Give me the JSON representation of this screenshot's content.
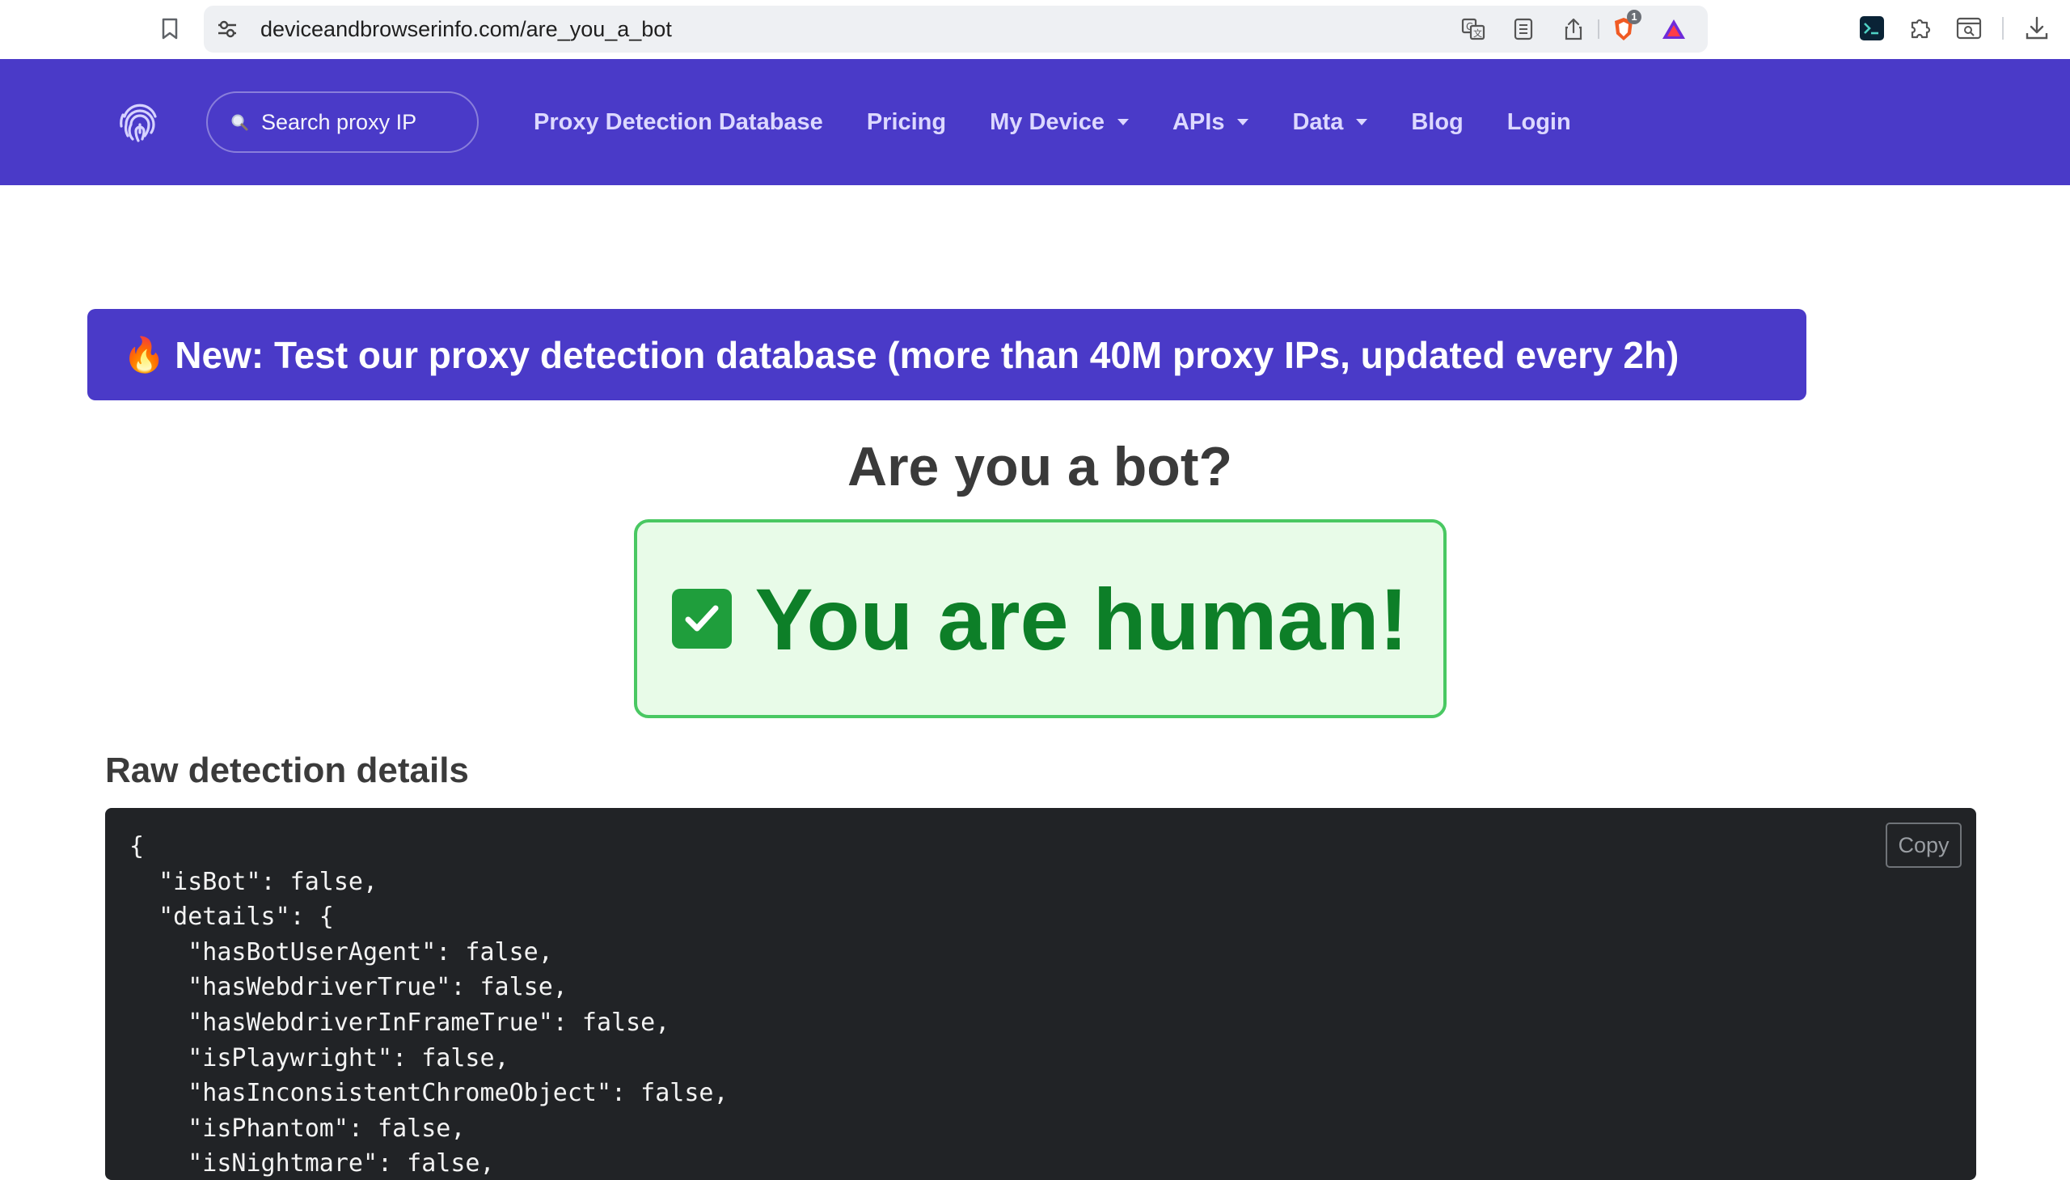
{
  "browser": {
    "url": "deviceandbrowserinfo.com/are_you_a_bot",
    "brave_shield_count": "1"
  },
  "navbar": {
    "search_placeholder": "Search proxy IP",
    "links": [
      {
        "label": "Proxy Detection Database",
        "dropdown": false
      },
      {
        "label": "Pricing",
        "dropdown": false
      },
      {
        "label": "My Device",
        "dropdown": true
      },
      {
        "label": "APIs",
        "dropdown": true
      },
      {
        "label": "Data",
        "dropdown": true
      },
      {
        "label": "Blog",
        "dropdown": false
      },
      {
        "label": "Login",
        "dropdown": false
      }
    ]
  },
  "banner": {
    "icon": "fire-icon",
    "text": "New: Test our proxy detection database (more than 40M proxy IPs, updated every 2h)"
  },
  "page": {
    "heading": "Are you a bot?",
    "result_text": "You are human!",
    "result_icon": "check-mark-icon",
    "details_heading": "Raw detection details"
  },
  "code": {
    "copy_label": "Copy",
    "lines": [
      "{",
      "  \"isBot\": false,",
      "  \"details\": {",
      "    \"hasBotUserAgent\": false,",
      "    \"hasWebdriverTrue\": false,",
      "    \"hasWebdriverInFrameTrue\": false,",
      "    \"isPlaywright\": false,",
      "    \"hasInconsistentChromeObject\": false,",
      "    \"isPhantom\": false,",
      "    \"isNightmare\": false,"
    ]
  },
  "colors": {
    "brand": "#4a3ac8",
    "success_text": "#0d7f28",
    "success_border": "#49c862",
    "success_bg": "#e8fbe8",
    "code_bg": "#212326"
  }
}
